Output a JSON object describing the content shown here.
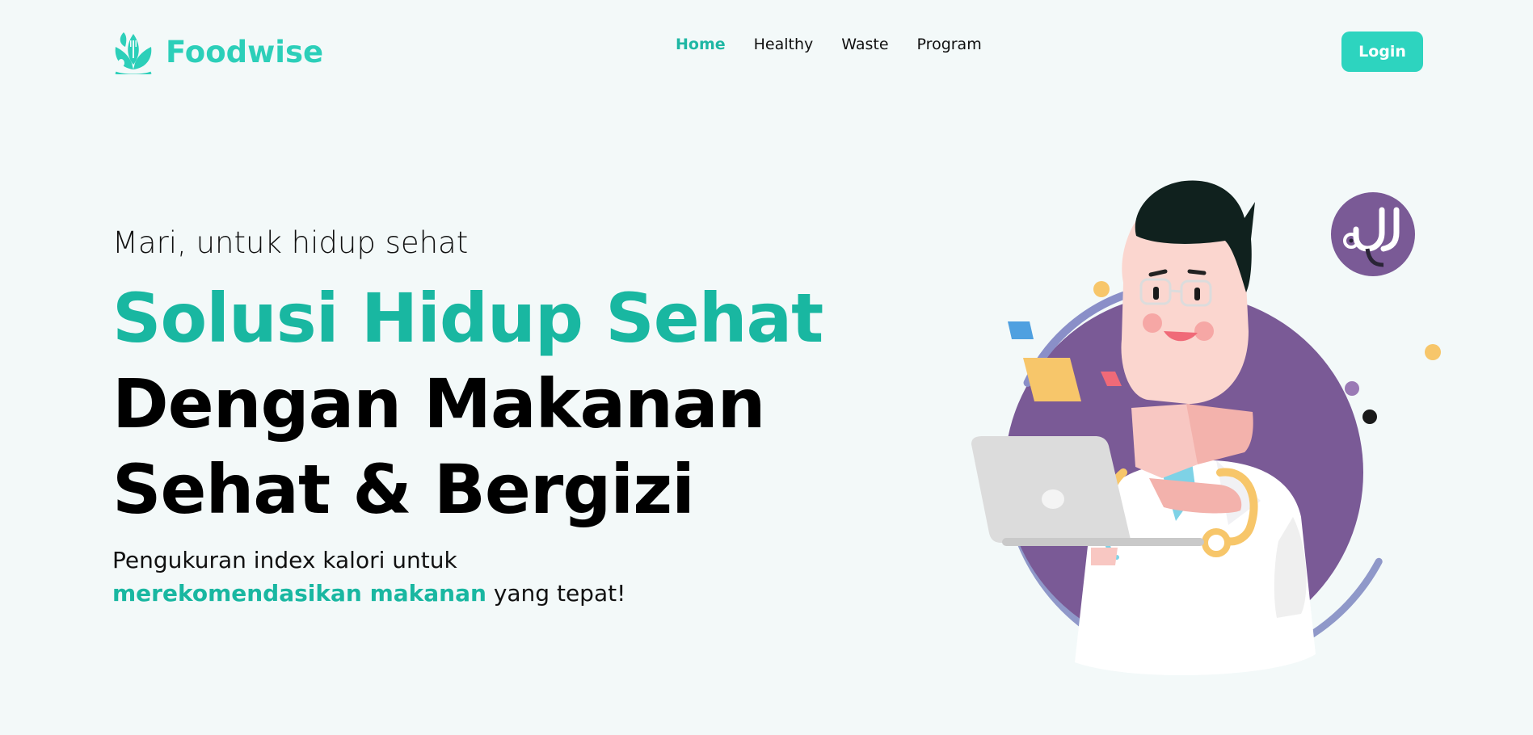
{
  "brand": {
    "name": "Foodwise",
    "logo_icon": "leaf-fork-spoon-icon"
  },
  "nav": {
    "items": [
      {
        "label": "Home",
        "active": true
      },
      {
        "label": "Healthy",
        "active": false
      },
      {
        "label": "Waste",
        "active": false
      },
      {
        "label": "Program",
        "active": false
      }
    ]
  },
  "login": {
    "label": "Login"
  },
  "hero": {
    "tagline": "Mari, untuk hidup sehat",
    "headline_accent": "Solusi Hidup Sehat",
    "headline_line2": "Dengan Makanan",
    "headline_line3": "Sehat & Bergizi",
    "desc_line1": "Pengukuran index kalori untuk",
    "desc_accent": "merekomendasikan makanan",
    "desc_tail": " yang tepat!"
  },
  "illustration": {
    "subject": "doctor-with-laptop-illustration",
    "badge_icon": "stethoscope-icon"
  },
  "colors": {
    "accent": "#2dd4bf",
    "accent_dark": "#19b7a1",
    "background": "#f3f9f9",
    "purple": "#7a5a96"
  }
}
